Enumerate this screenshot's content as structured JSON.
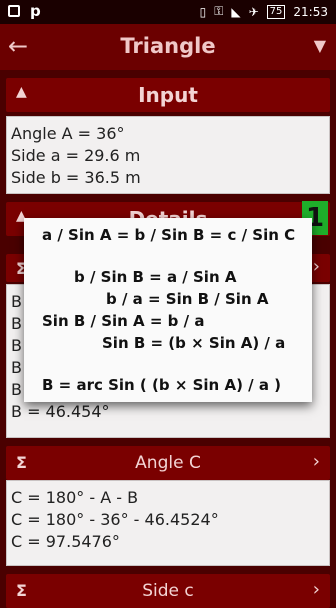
{
  "status": {
    "time": "21:53",
    "battery": "75"
  },
  "appbar": {
    "title": "Triangle",
    "back_icon": "arrow-left-icon",
    "dropdown_icon": "caret-down-icon"
  },
  "input": {
    "header": "Input",
    "lines": [
      "Angle A = 36°",
      "Side a = 29.6 m",
      "Side b = 36.5 m"
    ]
  },
  "details": {
    "header": "Details",
    "badge": "1",
    "partial_lines": [
      "B",
      "B",
      "B",
      "B",
      "B",
      "B = 46.454°"
    ]
  },
  "angle_c": {
    "header": "Angle C",
    "lines": [
      "C = 180° - A - B",
      "C = 180° - 36° - 46.4524°",
      "C = 97.5476°"
    ]
  },
  "side_c": {
    "header": "Side c"
  },
  "dialog": {
    "lines": [
      "a / Sin A = b / Sin B = c / Sin C",
      "b / Sin B = a / Sin A",
      "b / a = Sin B / Sin A",
      "Sin B / Sin A = b / a",
      "Sin B = (b × Sin A) / a",
      "B = arc Sin ( (b × Sin A) / a )"
    ]
  }
}
